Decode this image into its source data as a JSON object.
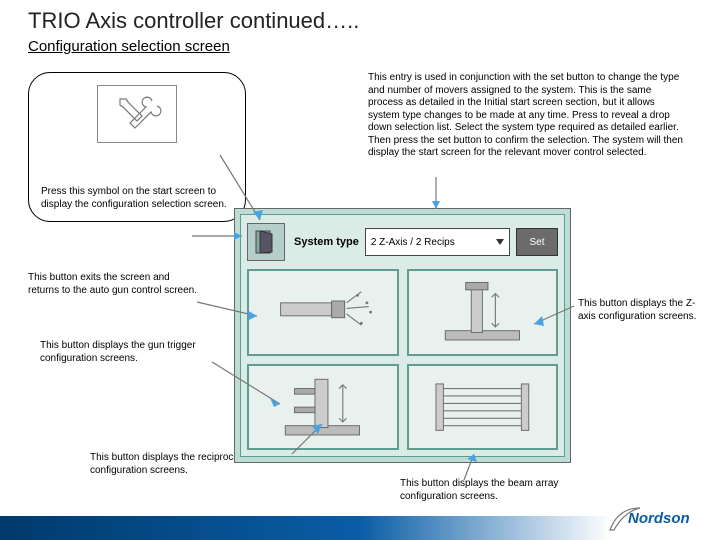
{
  "title": "TRIO Axis controller continued…..",
  "subtitle": "Configuration selection screen",
  "symbol_caption": "Press this symbol on the start screen to display the configuration selection screen.",
  "top_paragraph": "This entry is used in conjunction with the set button to change the type and number of movers assigned to the system. This is the same process as detailed in the Initial start screen section, but it allows system type changes to be made at any time. Press to reveal a drop down selection list. Select the system type required as detailed earlier. Then press the set button to confirm the selection. The system will then display the start screen for the relevant mover control selected.",
  "captions": {
    "exit": "This button exits the screen and returns to the auto gun control screen.",
    "z": "This button displays the Z-axis configuration screens.",
    "gun": "This button displays the gun trigger configuration screens.",
    "recip": "This button displays the reciprocator configuration screens.",
    "beam": "This button displays the beam array configuration screens."
  },
  "panel": {
    "system_type_label": "System type",
    "system_type_value": "2 Z-Axis / 2 Recips",
    "set_label": "Set"
  },
  "logo": "Nordson"
}
